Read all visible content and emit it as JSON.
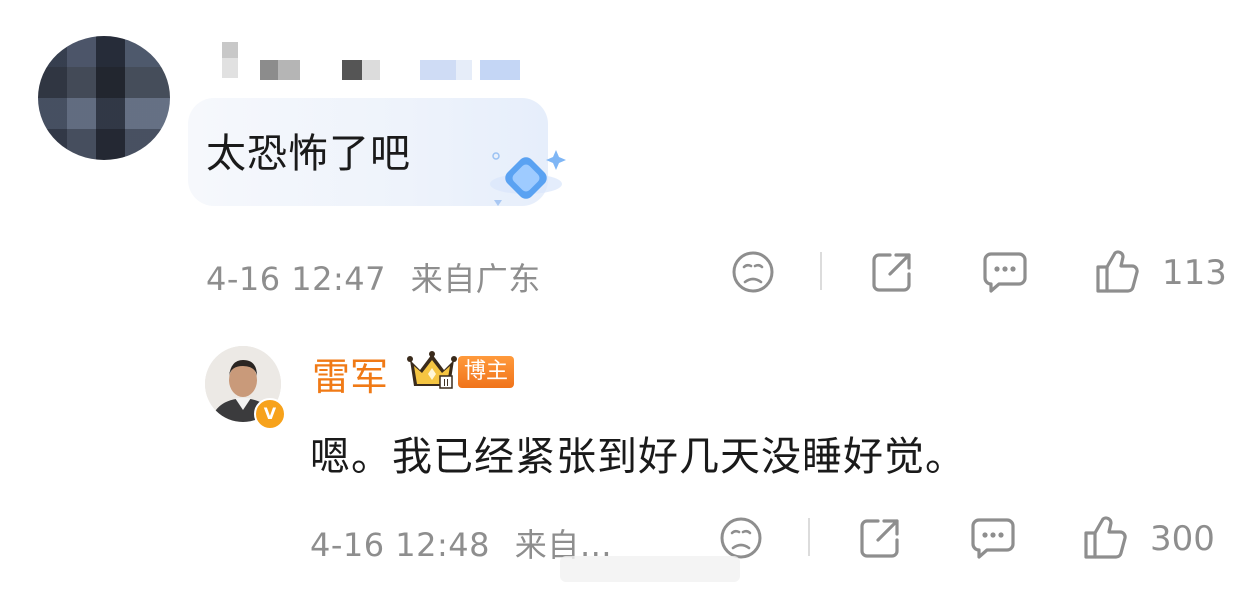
{
  "comment": {
    "text": "太恐怖了吧",
    "time": "4-16 12:47",
    "location": "来自广东",
    "likes": "113"
  },
  "reply": {
    "author": "雷军",
    "badge": "博主",
    "text": "嗯。我已经紧张到好几天没睡好觉。",
    "time": "4-16 12:48",
    "location": "来自…",
    "likes": "300"
  },
  "icons": [
    "sad-face-icon",
    "share-icon",
    "comment-icon",
    "thumbs-up-icon"
  ],
  "colors": {
    "author_name": "#f07a16",
    "meta_text": "#8e8e8e",
    "badge_bg": "#f0731a"
  }
}
